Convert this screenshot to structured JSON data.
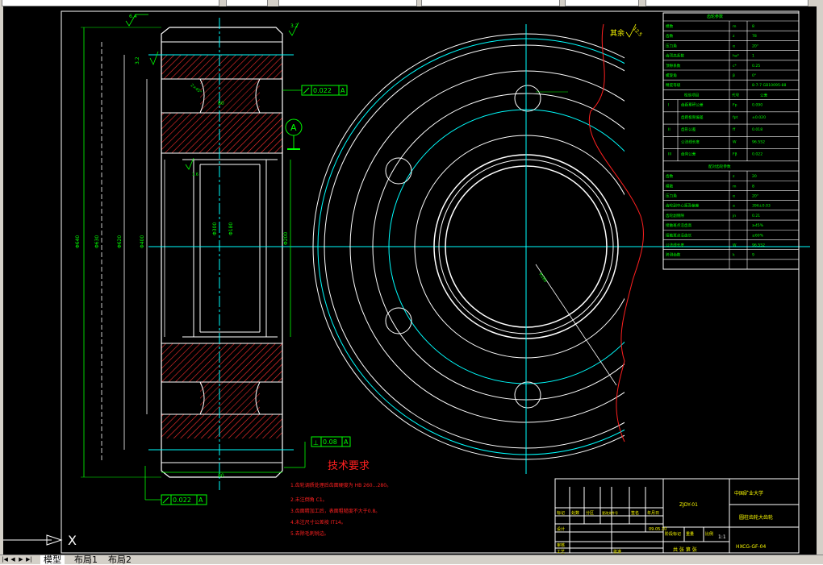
{
  "drawing": {
    "tolerances": {
      "runout_top": "0.022",
      "runout_bottom": "0.022",
      "flatness": "0.08",
      "datum": "A"
    },
    "roughness": {
      "r64": "6.4",
      "r32a": "3.2",
      "r32b": "3.2",
      "r125": "12.5",
      "r16": "1.6",
      "other_label": "其余"
    },
    "tech_req_title": "技术要求",
    "tech_requirements": [
      "1.齿轮调质处理后齿面硬度为 HB 260…280。",
      "2.未注倒角 C1。",
      "3.齿面精加工后，表面粗糙度不大于0.8。",
      "4.未注尺寸公差按 IT14。",
      "5.去除毛刺锐边。"
    ],
    "dims": {
      "d_root": "Φ620",
      "d_tip": "Φ640",
      "d_pitch": "Φ630",
      "d_hub": "Φ300",
      "d_bore": "Φ200",
      "d_bore2": "Φ180",
      "d_web": "Φ400",
      "width": "80",
      "hub_w": "80",
      "chamfer": "2×45°",
      "r_bolt": "R165"
    }
  },
  "param_table": {
    "title": "齿轮参数",
    "rows": [
      [
        "模数",
        "m",
        "8"
      ],
      [
        "齿数",
        "z",
        "78"
      ],
      [
        "压力角",
        "α",
        "20°"
      ],
      [
        "齿顶高系数",
        "ha*",
        "1"
      ],
      [
        "顶隙系数",
        "c*",
        "0.25"
      ],
      [
        "螺旋角",
        "β",
        "0°"
      ],
      [
        "精度等级",
        "",
        "8-7-7 GB10095-88"
      ]
    ],
    "check_head": [
      "检验项目",
      "代号",
      "公差"
    ],
    "check_rows": [
      [
        "I",
        "齿距累积公差",
        "Fp",
        "0.090"
      ],
      [
        "",
        "齿距极限偏差",
        "fpt",
        "±0.020"
      ],
      [
        "II",
        "齿形公差",
        "ff",
        "0.018"
      ],
      [
        "",
        "公法线长度",
        "W",
        "96.552"
      ],
      [
        "III",
        "齿向公差",
        "Fβ",
        "0.022"
      ]
    ],
    "mesh_title": "配对齿轮参数",
    "mesh_rows": [
      [
        "齿数",
        "z",
        "20"
      ],
      [
        "模数",
        "m",
        "8"
      ],
      [
        "压力角",
        "α",
        "20°"
      ],
      [
        "齿轮副中心距及偏差",
        "a",
        "396±0.03"
      ],
      [
        "齿轮副侧隙",
        "jn",
        "0.21"
      ],
      [
        "接触斑点沿齿高",
        "",
        "≥45%"
      ],
      [
        "接触斑点沿齿长",
        "",
        "≥60%"
      ],
      [
        "公法线长度",
        "W",
        "96.552"
      ],
      [
        "跨测齿数",
        "k",
        "9"
      ]
    ]
  },
  "title_block": {
    "drawing_no": "ZJDY-01",
    "school": "中国矿业大学",
    "part_name": "圆柱齿轮大齿轮",
    "scale": "1:1",
    "sheet": "共 张 第 张",
    "code": "HXCG-GF-04",
    "date": "09.05.10",
    "row_labels": [
      "标记",
      "处数",
      "分区",
      "更改文件号",
      "签名",
      "年月日"
    ],
    "lower_labels": [
      "设计",
      "审核",
      "工艺",
      "批准"
    ],
    "stage_labels": [
      "阶段标记",
      "重量",
      "比例"
    ]
  },
  "ucs": {
    "x_label": "X"
  },
  "layout_tabs": {
    "model": "模型",
    "layout1": "布局1",
    "layout2": "布局2"
  },
  "colors": {
    "background": "#000000",
    "outline": "#ffffff",
    "centerline": "#00ffff",
    "dimension": "#00ff00",
    "text": "#ffff00",
    "border": "#ff0000",
    "hatch": "#ff0000",
    "ui": "#d4d0c8"
  }
}
